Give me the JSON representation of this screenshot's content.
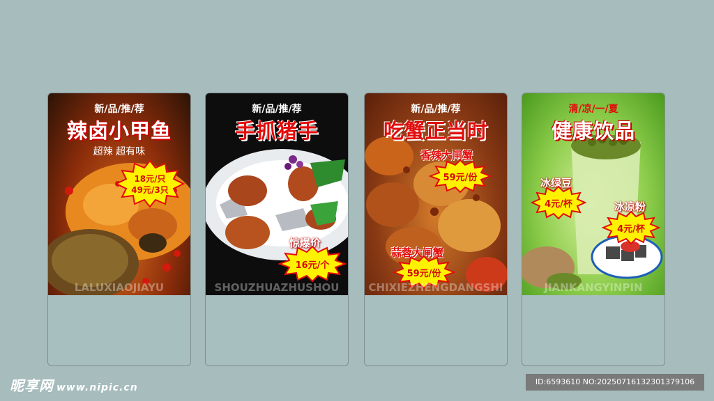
{
  "cards": [
    {
      "tagline": "新/品/推/荐",
      "title": "辣卤小甲鱼",
      "subtitle": "超辣 超有味",
      "price_line1": "18元/只",
      "price_line2": "49元/3只",
      "watermark": "LALUXIAOJIAYU"
    },
    {
      "tagline": "新/品/推/荐",
      "title": "手抓猪手",
      "promo_label": "惊爆价",
      "price": "16元/个",
      "watermark": "SHOUZHUAZHUSHOU"
    },
    {
      "tagline": "新/品/推/荐",
      "title": "吃蟹正当时",
      "item1_name": "香辣大闸蟹",
      "item1_price": "59元/份",
      "item2_name": "蒜蓉大闸蟹",
      "item2_price": "59元/份",
      "watermark": "CHIXIEZHENGDANGSHI"
    },
    {
      "tagline": "清/凉/一/夏",
      "title": "健康饮品",
      "item1_name": "冰绿豆",
      "item1_price": "4元/杯",
      "item2_name": "冰凉粉",
      "item2_price": "4元/杯",
      "watermark": "JIANKANGYINPIN"
    }
  ],
  "footer": {
    "logo": "昵享网",
    "url": "www.nipic.cn",
    "id_text": "ID:6593610 NO:20250716132301379106"
  },
  "colors": {
    "background": "#a6bcbd",
    "title_red": "#e30b0b",
    "title_white": "#ffffff",
    "price_red": "#d60a0a",
    "burst_yellow": "#fff200"
  }
}
